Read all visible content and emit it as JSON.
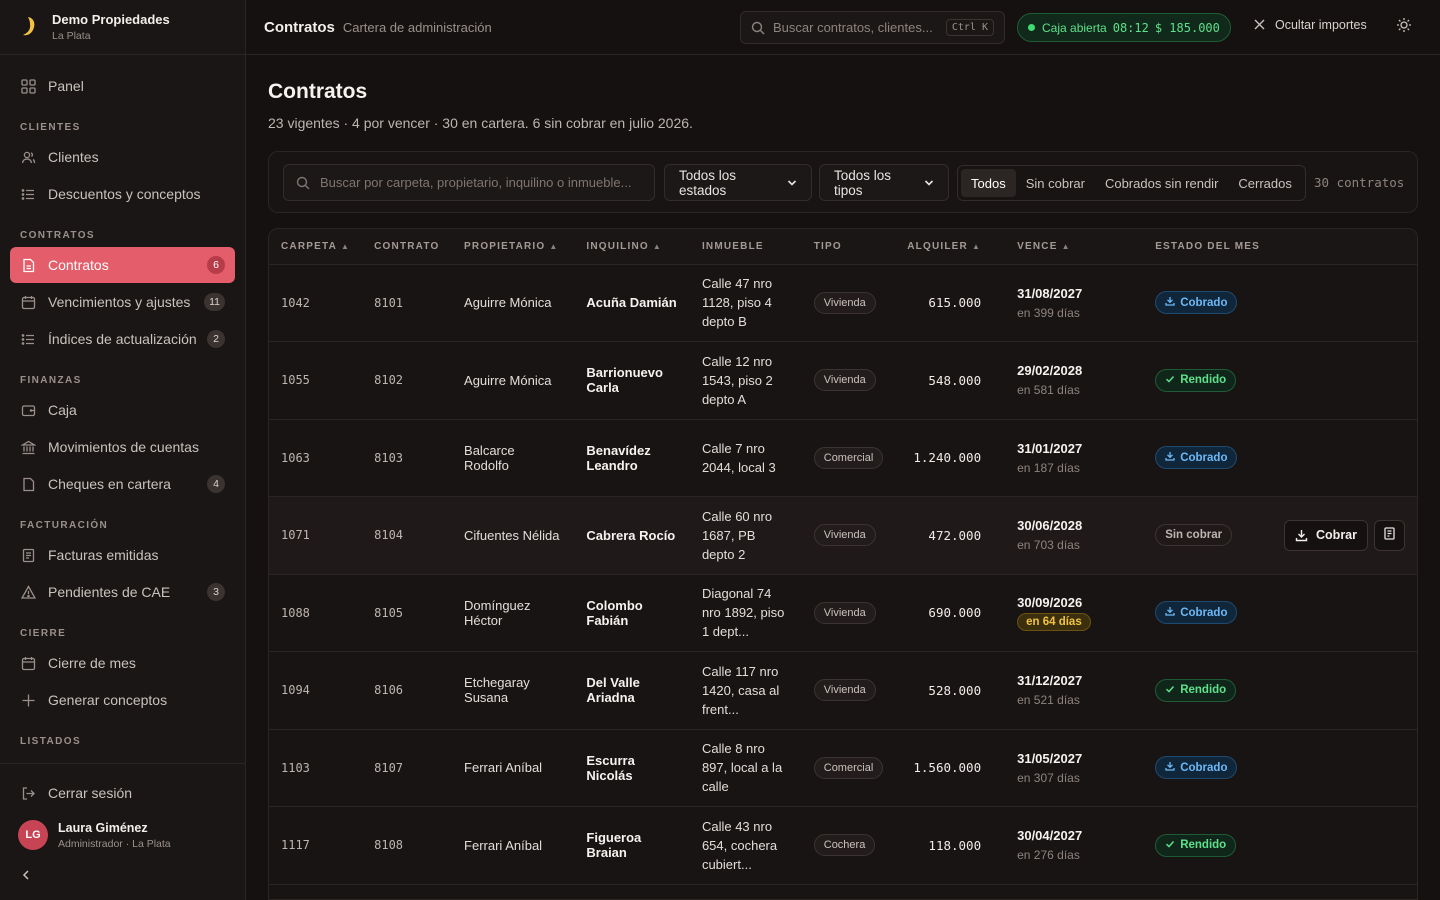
{
  "brand": {
    "name": "Demo Propiedades",
    "sub": "La Plata"
  },
  "nav": {
    "panel": "Panel",
    "sections": {
      "clientes": "CLIENTES",
      "contratos": "CONTRATOS",
      "finanzas": "FINANZAS",
      "facturacion": "FACTURACIÓN",
      "cierre": "CIERRE",
      "listados": "LISTADOS"
    },
    "clientes": "Clientes",
    "descuentos": "Descuentos y conceptos",
    "contratos": {
      "label": "Contratos",
      "badge": "6"
    },
    "vencimientos": {
      "label": "Vencimientos y ajustes",
      "badge": "11"
    },
    "indices": {
      "label": "Índices de actualización",
      "badge": "2"
    },
    "caja": "Caja",
    "movimientos": "Movimientos de cuentas",
    "cheques": {
      "label": "Cheques en cartera",
      "badge": "4"
    },
    "facturas": "Facturas emitidas",
    "cae": {
      "label": "Pendientes de CAE",
      "badge": "3"
    },
    "cierre_mes": "Cierre de mes",
    "generar": "Generar conceptos",
    "logout": "Cerrar sesión"
  },
  "user": {
    "initials": "LG",
    "name": "Laura Giménez",
    "role": "Administrador · La Plata"
  },
  "topbar": {
    "title": "Contratos",
    "subtitle": "Cartera de administración",
    "search_placeholder": "Buscar contratos, clientes...",
    "shortcut": "Ctrl K",
    "caja": {
      "label": "Caja abierta",
      "time": "08:12",
      "amount": "$ 185.000"
    },
    "hide_amounts": "Ocultar importes"
  },
  "page": {
    "title": "Contratos",
    "subtitle": "23 vigentes · 4 por vencer · 30 en cartera. 6 sin cobrar en julio 2026."
  },
  "filters": {
    "search_placeholder": "Buscar por carpeta, propietario, inquilino o inmueble...",
    "estado": "Todos los estados",
    "tipo": "Todos los tipos",
    "segments": [
      "Todos",
      "Sin cobrar",
      "Cobrados sin rendir",
      "Cerrados"
    ],
    "count": "30 contratos"
  },
  "table": {
    "headers": {
      "carpeta": "CARPETA",
      "contrato": "CONTRATO",
      "propietario": "PROPIETARIO",
      "inquilino": "INQUILINO",
      "inmueble": "INMUEBLE",
      "tipo": "TIPO",
      "alquiler": "ALQUILER",
      "vence": "VENCE",
      "estado": "ESTADO DEL MES"
    },
    "actions": {
      "cobrar": "Cobrar"
    },
    "rows": [
      {
        "carpeta": "1042",
        "contrato": "8101",
        "propietario": "Aguirre Mónica",
        "inquilino": "Acuña Damián",
        "inmueble": "Calle 47 nro 1128, piso 4 depto B",
        "tipo": "Vivienda",
        "alquiler": "615.000",
        "vence": "31/08/2027",
        "dias": "en 399 días",
        "estado": "Cobrado"
      },
      {
        "carpeta": "1055",
        "contrato": "8102",
        "propietario": "Aguirre Mónica",
        "inquilino": "Barrionuevo Carla",
        "inmueble": "Calle 12 nro 1543, piso 2 depto A",
        "tipo": "Vivienda",
        "alquiler": "548.000",
        "vence": "29/02/2028",
        "dias": "en 581 días",
        "estado": "Rendido"
      },
      {
        "carpeta": "1063",
        "contrato": "8103",
        "propietario": "Balcarce Rodolfo",
        "inquilino": "Benavídez Leandro",
        "inmueble": "Calle 7 nro 2044, local 3",
        "tipo": "Comercial",
        "alquiler": "1.240.000",
        "vence": "31/01/2027",
        "dias": "en 187 días",
        "estado": "Cobrado"
      },
      {
        "carpeta": "1071",
        "contrato": "8104",
        "propietario": "Cifuentes Nélida",
        "inquilino": "Cabrera Rocío",
        "inmueble": "Calle 60 nro 1687, PB depto 2",
        "tipo": "Vivienda",
        "alquiler": "472.000",
        "vence": "30/06/2028",
        "dias": "en 703 días",
        "estado": "Sin cobrar"
      },
      {
        "carpeta": "1088",
        "contrato": "8105",
        "propietario": "Domínguez Héctor",
        "inquilino": "Colombo Fabián",
        "inmueble": "Diagonal 74 nro 1892, piso 1 dept...",
        "tipo": "Vivienda",
        "alquiler": "690.000",
        "vence": "30/09/2026",
        "dias": "en 64 días",
        "estado": "Cobrado"
      },
      {
        "carpeta": "1094",
        "contrato": "8106",
        "propietario": "Etchegaray Susana",
        "inquilino": "Del Valle Ariadna",
        "inmueble": "Calle 117 nro 1420, casa al frent...",
        "tipo": "Vivienda",
        "alquiler": "528.000",
        "vence": "31/12/2027",
        "dias": "en 521 días",
        "estado": "Rendido"
      },
      {
        "carpeta": "1103",
        "contrato": "8107",
        "propietario": "Ferrari Aníbal",
        "inquilino": "Escurra Nicolás",
        "inmueble": "Calle 8 nro 897, local a la calle",
        "tipo": "Comercial",
        "alquiler": "1.560.000",
        "vence": "31/05/2027",
        "dias": "en 307 días",
        "estado": "Cobrado"
      },
      {
        "carpeta": "1117",
        "contrato": "8108",
        "propietario": "Ferrari Aníbal",
        "inquilino": "Figueroa Braian",
        "inmueble": "Calle 43 nro 654, cochera cubiert...",
        "tipo": "Cochera",
        "alquiler": "118.000",
        "vence": "30/04/2027",
        "dias": "en 276 días",
        "estado": "Rendido"
      }
    ]
  }
}
